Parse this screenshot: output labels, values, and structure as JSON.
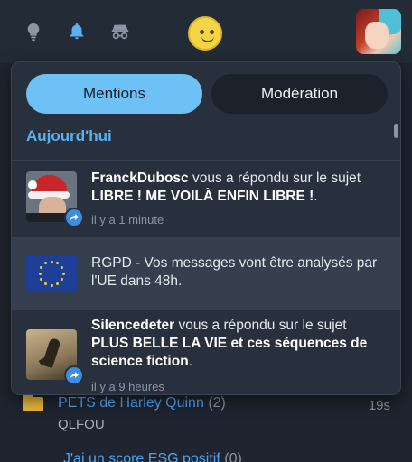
{
  "topbar": {
    "icons": [
      "lightbulb-icon",
      "bell-icon",
      "incognito-icon"
    ],
    "smiley": "smiley-emoji",
    "accent": "#5ab0f0"
  },
  "panel": {
    "tabs": [
      {
        "label": "Mentions",
        "active": true
      },
      {
        "label": "Modération",
        "active": false
      }
    ],
    "section_title": "Aujourd'hui",
    "notifications": [
      {
        "user": "FranckDubosc",
        "pre": " vous a répondu sur le sujet ",
        "subject": "LIBRE ! ME VOILÀ ENFIN LIBRE !",
        "post": ".",
        "time": "il y a 1 minute",
        "icon": "reply-icon",
        "highlight": false
      },
      {
        "text": "RGPD - Vos messages vont être analysés par l'UE dans 48h.",
        "highlight": true
      },
      {
        "user": "Silencedeter",
        "pre": " vous a répondu sur le sujet ",
        "subject": "PLUS BELLE LA VIE et ces séquences de science fiction",
        "post": ".",
        "time": "il y a 9 heures",
        "icon": "reply-icon",
        "highlight": false
      }
    ]
  },
  "topics": [
    {
      "title": "PETS de Harley Quinn",
      "count": "(2)",
      "author": "QLFOU",
      "time": "19s"
    },
    {
      "title": "J'ai un score ESG positif",
      "count": "(0)"
    }
  ]
}
